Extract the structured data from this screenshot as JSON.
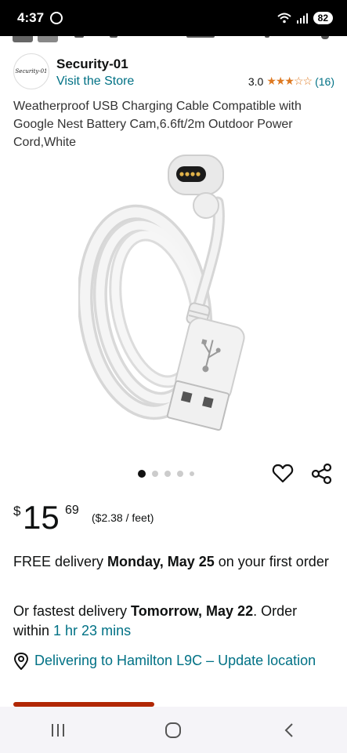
{
  "status_bar": {
    "time": "4:37",
    "battery": "82"
  },
  "seller": {
    "logo_text": "Security-01",
    "name": "Security-01",
    "visit_link": "Visit the Store",
    "rating_value": "3.0",
    "stars": "★★★☆☆",
    "rating_count": "(16)"
  },
  "product": {
    "title": "Weatherproof USB Charging Cable Compatible with Google Nest Battery Cam,6.6ft/2m Outdoor Power Cord,White"
  },
  "gallery": {
    "dot_count": 5,
    "active_index": 0
  },
  "price": {
    "currency": "$",
    "whole": "15",
    "fraction": "69",
    "unit_price": "($2.38 / feet)"
  },
  "delivery": {
    "free_prefix": "FREE delivery ",
    "free_date": "Monday, May 25",
    "free_suffix": " on your first order",
    "fast_prefix": "Or fastest delivery ",
    "fast_date": "Tomorrow, May 22",
    "fast_mid": ". Order within ",
    "fast_countdown": "1 hr 23 mins"
  },
  "location": {
    "text": "Delivering to Hamilton L9C – Update location"
  },
  "colors": {
    "link": "#007185",
    "star": "#de7921",
    "stock": "#b12704"
  },
  "icons": [
    "heart-icon",
    "share-icon",
    "location-pin-icon",
    "recent-apps-icon",
    "home-icon",
    "back-icon"
  ]
}
